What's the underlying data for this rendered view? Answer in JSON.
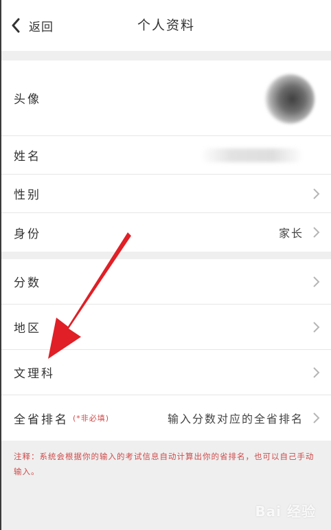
{
  "navbar": {
    "back_label": "返回",
    "title": "个人资料"
  },
  "profile": {
    "avatar_label": "头像",
    "name_label": "姓名",
    "gender_label": "性别",
    "identity_label": "身份",
    "identity_value": "家长"
  },
  "academic": {
    "score_label": "分数",
    "region_label": "地区",
    "track_label": "文理科",
    "rank_label": "全省排名",
    "rank_sub": "(*非必填)",
    "rank_placeholder": "输入分数对应的全省排名"
  },
  "note": "注释：系统会根据你的输入的考试信息自动计算出你的省排名，也可以自己手动输入。",
  "watermark": "Bai 经验",
  "colors": {
    "accent_red": "#e01f26",
    "note_red": "#d04a4a",
    "background": "#efefef"
  }
}
